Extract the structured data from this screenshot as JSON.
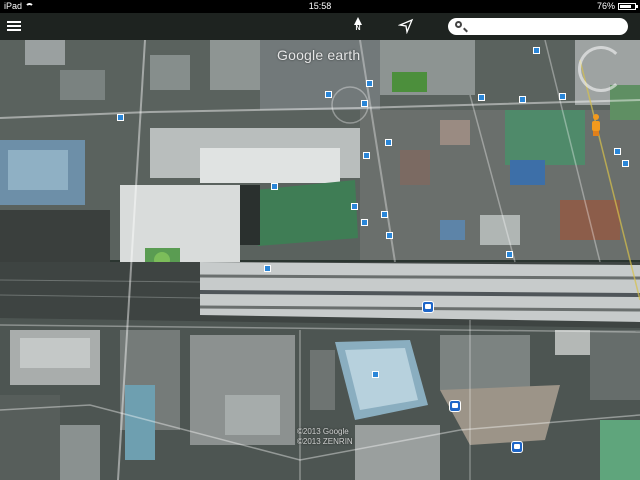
{
  "status_bar": {
    "device": "iPad",
    "time": "15:58",
    "battery_percent": "76%",
    "battery_level": 0.76
  },
  "toolbar": {
    "menu_icon": "hamburger-menu-icon",
    "compass_label": "N",
    "location_icon": "location-arrow-icon",
    "search_icon": "search-icon",
    "search_value": ""
  },
  "map": {
    "watermark": "Google earth",
    "copyright_line1": "©2013 Google",
    "copyright_line2": "©2013 ZENRIN",
    "colors": {
      "poi_blue": "#2a86d8",
      "transit_blue": "#1e66c8",
      "pegman_orange": "#f39a1d"
    }
  }
}
